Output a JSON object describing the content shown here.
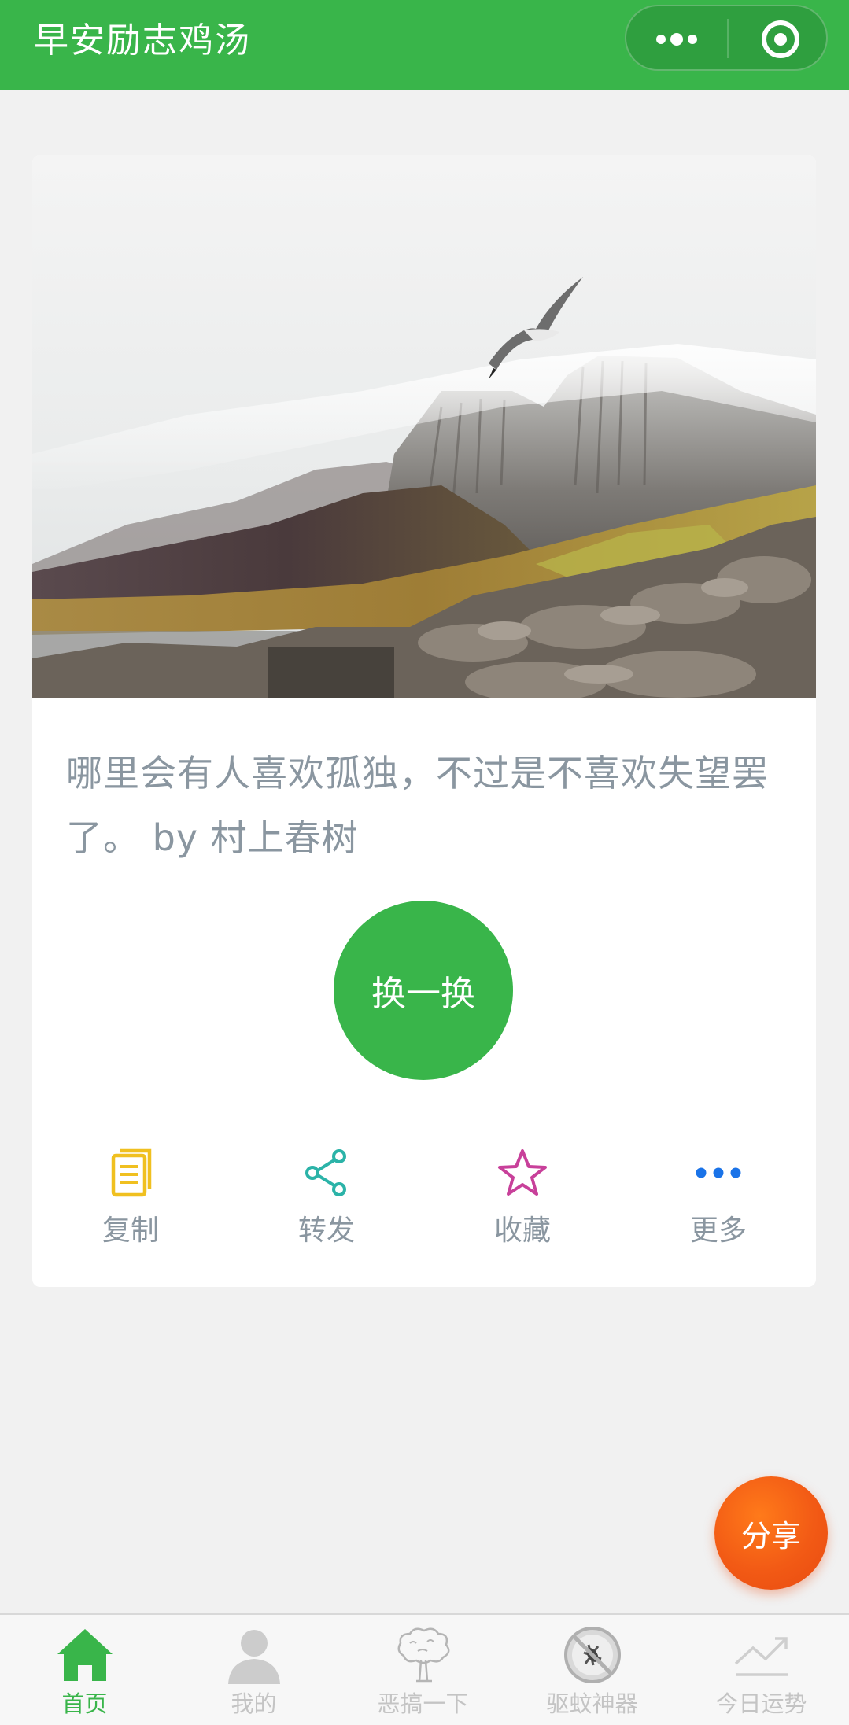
{
  "header": {
    "title": "早安励志鸡汤",
    "more_icon": "more-dots-icon",
    "close_icon": "target-circle-icon",
    "bg_color": "#39b54a"
  },
  "card": {
    "quote": "哪里会有人喜欢孤独，不过是不喜欢失望罢了。 by 村上春树",
    "refresh_label": "换一换",
    "actions": [
      {
        "label": "复制",
        "icon": "copy-document-icon",
        "color": "#f0c020"
      },
      {
        "label": "转发",
        "icon": "share-nodes-icon",
        "color": "#2bb3a8"
      },
      {
        "label": "收藏",
        "icon": "star-outline-icon",
        "color": "#c8409a"
      },
      {
        "label": "更多",
        "icon": "more-dots-icon",
        "color": "#1a73e8"
      }
    ]
  },
  "fab": {
    "label": "分享"
  },
  "tabbar": {
    "items": [
      {
        "label": "首页",
        "icon": "home-icon",
        "active": true
      },
      {
        "label": "我的",
        "icon": "person-icon",
        "active": false
      },
      {
        "label": "恶搞一下",
        "icon": "tree-cloud-icon",
        "active": false
      },
      {
        "label": "驱蚊神器",
        "icon": "no-mosquito-icon",
        "active": false
      },
      {
        "label": "今日运势",
        "icon": "trend-line-icon",
        "active": false
      }
    ],
    "active_color": "#39b54a",
    "inactive_color": "#c4c4c4"
  }
}
